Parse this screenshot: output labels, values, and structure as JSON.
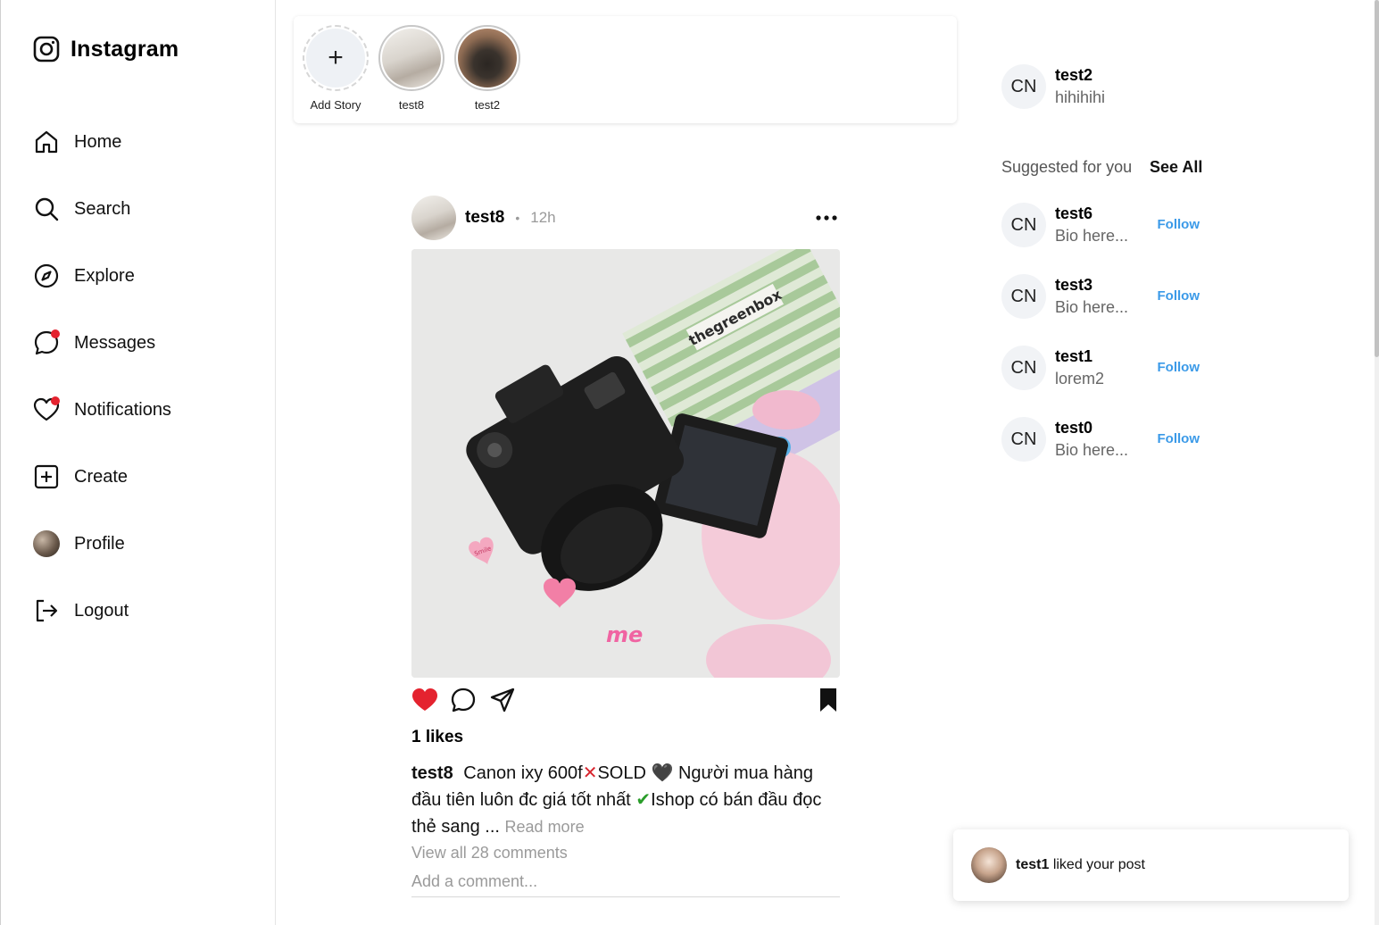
{
  "brand": {
    "title": "Instagram",
    "icon": "instagram-logo-icon"
  },
  "nav": [
    {
      "label": "Home",
      "icon": "home-icon",
      "dot": false
    },
    {
      "label": "Search",
      "icon": "search-icon",
      "dot": false
    },
    {
      "label": "Explore",
      "icon": "compass-icon",
      "dot": false
    },
    {
      "label": "Messages",
      "icon": "message-icon",
      "dot": true
    },
    {
      "label": "Notifications",
      "icon": "heart-icon",
      "dot": true
    },
    {
      "label": "Create",
      "icon": "plus-square-icon",
      "dot": false
    },
    {
      "label": "Profile",
      "icon": "avatar",
      "dot": false
    },
    {
      "label": "Logout",
      "icon": "logout-icon",
      "dot": false
    }
  ],
  "stories": [
    {
      "label": "Add Story",
      "type": "add",
      "symbol": "+"
    },
    {
      "label": "test8",
      "type": "user"
    },
    {
      "label": "test2",
      "type": "user"
    }
  ],
  "post": {
    "username": "test8",
    "dot": "•",
    "time": "12h",
    "likes": "1 likes",
    "caption_user": "test8",
    "caption_part1": "Canon ixy 600f",
    "caption_sold": "SOLD",
    "caption_part2": "Người mua hàng đầu tiên luôn đc giá tốt nhất",
    "caption_part3": "Ishop có bán đầu đọc thẻ sang ...",
    "read_more": "Read more",
    "view_comments": "View all 28 comments",
    "comment_placeholder": "Add a comment...",
    "photo_text_box": "thegreenbox",
    "photo_text_sticker": "me",
    "photo_text_heart": "Smile",
    "liked": true,
    "saved": true,
    "colors": {
      "like": "#e4232f",
      "link": "#3b9ae8"
    }
  },
  "me": {
    "avatar": "CN",
    "name": "test2",
    "bio": "hihihihi"
  },
  "suggested": {
    "title": "Suggested for you",
    "see_all": "See All",
    "follow_label": "Follow",
    "users": [
      {
        "avatar": "CN",
        "name": "test6",
        "bio": "Bio here..."
      },
      {
        "avatar": "CN",
        "name": "test3",
        "bio": "Bio here..."
      },
      {
        "avatar": "CN",
        "name": "test1",
        "bio": "lorem2"
      },
      {
        "avatar": "CN",
        "name": "test0",
        "bio": "Bio here..."
      }
    ]
  },
  "toast": {
    "user": "test1",
    "text": "liked your post"
  }
}
